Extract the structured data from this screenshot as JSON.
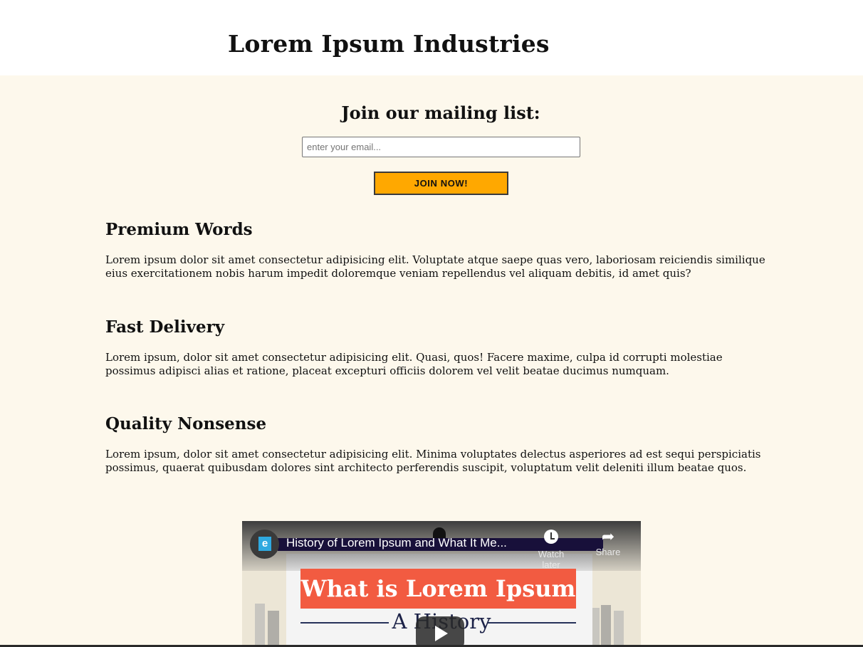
{
  "header": {
    "brand": "Lorem Ipsum Industries"
  },
  "mailing": {
    "title": "Join our mailing list:",
    "email_placeholder": "enter your email...",
    "email_value": "",
    "join_label": "JOIN NOW!"
  },
  "features": [
    {
      "title": "Premium Words",
      "text": "Lorem ipsum dolor sit amet consectetur adipisicing elit. Voluptate atque saepe quas vero, laboriosam reiciendis similique eius exercitationem nobis harum impedit doloremque veniam repellendus vel aliquam debitis, id amet quis?"
    },
    {
      "title": "Fast Delivery",
      "text": "Lorem ipsum, dolor sit amet consectetur adipisicing elit. Quasi, quos! Facere maxime, culpa id corrupti molestiae possimus adipisci alias et ratione, placeat excepturi officiis dolorem vel velit beatae ducimus numquam."
    },
    {
      "title": "Quality Nonsense",
      "text": "Lorem ipsum, dolor sit amet consectetur adipisicing elit. Minima voluptates delectus asperiores ad est sequi perspiciatis possimus, quaerat quibusdam dolores sint architecto perferendis suscipit, voluptatum velit deleniti illum beatae quos."
    }
  ],
  "video": {
    "title": "History of Lorem Ipsum and What It Me...",
    "channel_initial": "e",
    "watch_later_label": "Watch later",
    "share_label": "Share",
    "banner_text": "What is Lorem Ipsum",
    "subtitle_text": "A History",
    "icons": {
      "watch_later": "clock-icon",
      "share": "share-arrow-icon",
      "play": "play-icon"
    },
    "colors": {
      "banner": "#f25b41",
      "title_bar": "#18103a"
    }
  },
  "colors": {
    "page_bg": "#fdf8ec",
    "button_bg": "#ffa800"
  }
}
